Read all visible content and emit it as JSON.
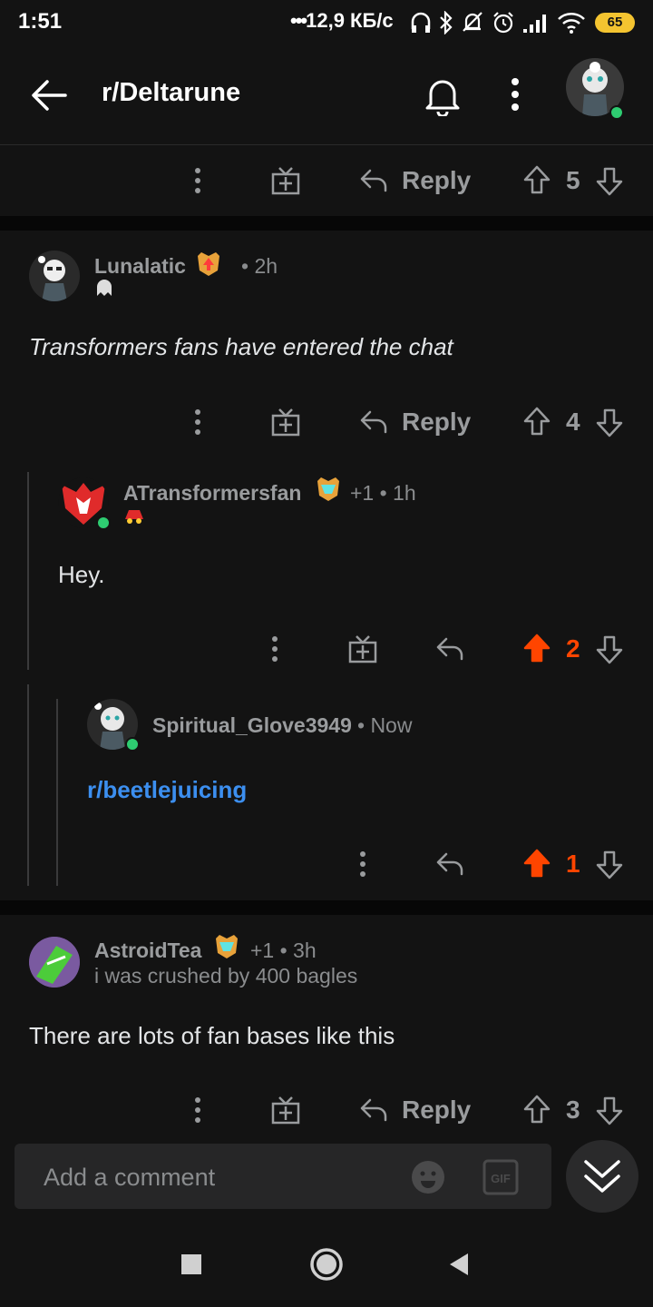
{
  "status_bar": {
    "time": "1:51",
    "speed": "12,9 КБ/с",
    "battery": "65"
  },
  "header": {
    "subreddit": "r/Deltarune"
  },
  "top_actions": {
    "reply_label": "Reply",
    "votes": "5"
  },
  "comments": [
    {
      "username": "Lunalatic",
      "meta": "• 2h",
      "body": "Transformers fans have entered the chat",
      "reply_label": "Reply",
      "votes": "4"
    },
    {
      "username": "ATransformersfan",
      "meta": "+1 • 1h",
      "body": "Hey.",
      "votes": "2"
    },
    {
      "username": "Spiritual_Glove3949",
      "meta": "• Now",
      "body": "r/beetlejuicing",
      "votes": "1"
    },
    {
      "username": "AstroidTea",
      "meta": "+1 • 3h",
      "flair": "i was crushed by 400 bagles",
      "body": "There are lots of fan bases like this",
      "reply_label": "Reply",
      "votes": "3"
    }
  ],
  "composer": {
    "placeholder": "Add a comment"
  },
  "colors": {
    "background": "#131313",
    "upvote_active": "#ff4500",
    "link": "#3c8ff0",
    "online": "#2ecc71"
  }
}
